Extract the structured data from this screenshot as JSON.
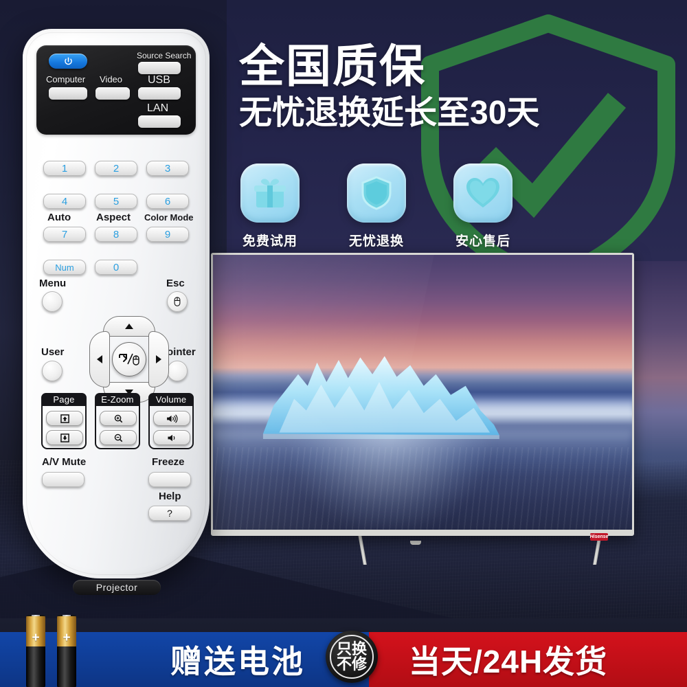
{
  "headline": {
    "line1": "全国质保",
    "line2": "无忧退换延长至30天"
  },
  "badges": [
    {
      "icon": "gift-icon",
      "label": "免费试用"
    },
    {
      "icon": "shield-icon",
      "label": "无忧退换"
    },
    {
      "icon": "heart-icon",
      "label": "安心售后"
    }
  ],
  "watermark": {
    "icon": "shield-check-icon",
    "color": "#2f7a41"
  },
  "remote": {
    "brand_tag": "Projector",
    "top_panel": {
      "power_icon": "power-icon",
      "source_search_label": "Source Search",
      "computer_label": "Computer",
      "video_label": "Video",
      "usb_label": "USB",
      "lan_label": "LAN"
    },
    "numpad": {
      "keys": [
        "1",
        "2",
        "3",
        "4",
        "5",
        "6",
        "7",
        "8",
        "9",
        "Num",
        "0"
      ],
      "sublabels": [
        "Auto",
        "Aspect",
        "Color Mode"
      ]
    },
    "nav": {
      "menu_label": "Menu",
      "esc_label": "Esc",
      "user_label": "User",
      "pointer_label": "Pointer",
      "up_icon": "arrow-up-icon",
      "down_icon": "arrow-down-icon",
      "left_icon": "arrow-left-icon",
      "right_icon": "arrow-right-icon",
      "center_icon": "enter-mouse-icon",
      "esc_icon": "mouse-icon"
    },
    "groups": [
      {
        "title": "Page",
        "up_icon": "page-up-icon",
        "down_icon": "page-down-icon"
      },
      {
        "title": "E-Zoom",
        "up_icon": "zoom-in-icon",
        "down_icon": "zoom-out-icon"
      },
      {
        "title": "Volume",
        "up_icon": "volume-up-icon",
        "down_icon": "volume-down-icon"
      }
    ],
    "bottom": {
      "av_mute_label": "A/V Mute",
      "freeze_label": "Freeze",
      "help_label": "Help",
      "help_key": "?"
    }
  },
  "tv": {
    "logo_text": "Hisense"
  },
  "banner": {
    "gift_text": "赠送电池",
    "seal_line1": "只换",
    "seal_line2": "不修",
    "ship_text": "当天/24H发货",
    "blue": "#0d3585",
    "red": "#c8111b"
  }
}
